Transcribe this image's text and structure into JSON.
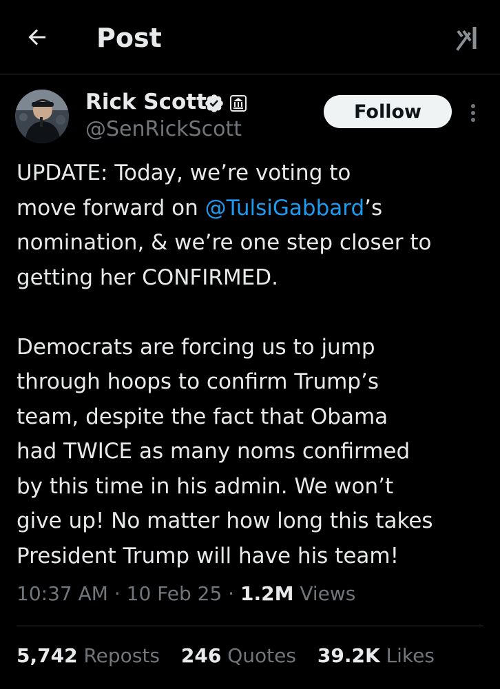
{
  "header": {
    "title": "Post",
    "back_icon": "arrow-left-icon",
    "grok_icon": "grok-icon"
  },
  "author": {
    "name": "Rick Scott",
    "handle": "@SenRickScott",
    "verified_icon": "verified-badge-icon",
    "affiliation_icon": "government-badge-icon",
    "follow_label": "Follow",
    "more_icon": "more-vertical-icon"
  },
  "tweet": {
    "lines": [
      [
        "UPDATE: Today, we’re voting to"
      ],
      [
        "move forward on ",
        "@TulsiGabbard",
        "’s"
      ],
      [
        "nomination, & we’re one step closer to"
      ],
      [
        "getting her CONFIRMED."
      ],
      [
        ""
      ],
      [
        "Democrats are forcing us to jump"
      ],
      [
        "through hoops to confirm Trump’s"
      ],
      [
        "team, despite the fact that Obama"
      ],
      [
        "had TWICE as many noms confirmed"
      ],
      [
        "by this time in his admin. We won’t"
      ],
      [
        "give up! No matter how long this takes"
      ],
      [
        "President Trump will have his team!"
      ]
    ],
    "mention": "@TulsiGabbard"
  },
  "meta": {
    "time": "10:37 AM",
    "separator": "·",
    "date": "10 Feb 25",
    "views_count": "1.2M",
    "views_label": "Views"
  },
  "stats": {
    "reposts_count": "5,742",
    "reposts_label": "Reposts",
    "quotes_count": "246",
    "quotes_label": "Quotes",
    "likes_count": "39.2K",
    "likes_label": "Likes"
  },
  "colors": {
    "background": "#000000",
    "text": "#e7e9ea",
    "secondary": "#71767b",
    "link": "#1d9bf0",
    "verified": "#1d9bf0",
    "divider": "#2f3336"
  }
}
